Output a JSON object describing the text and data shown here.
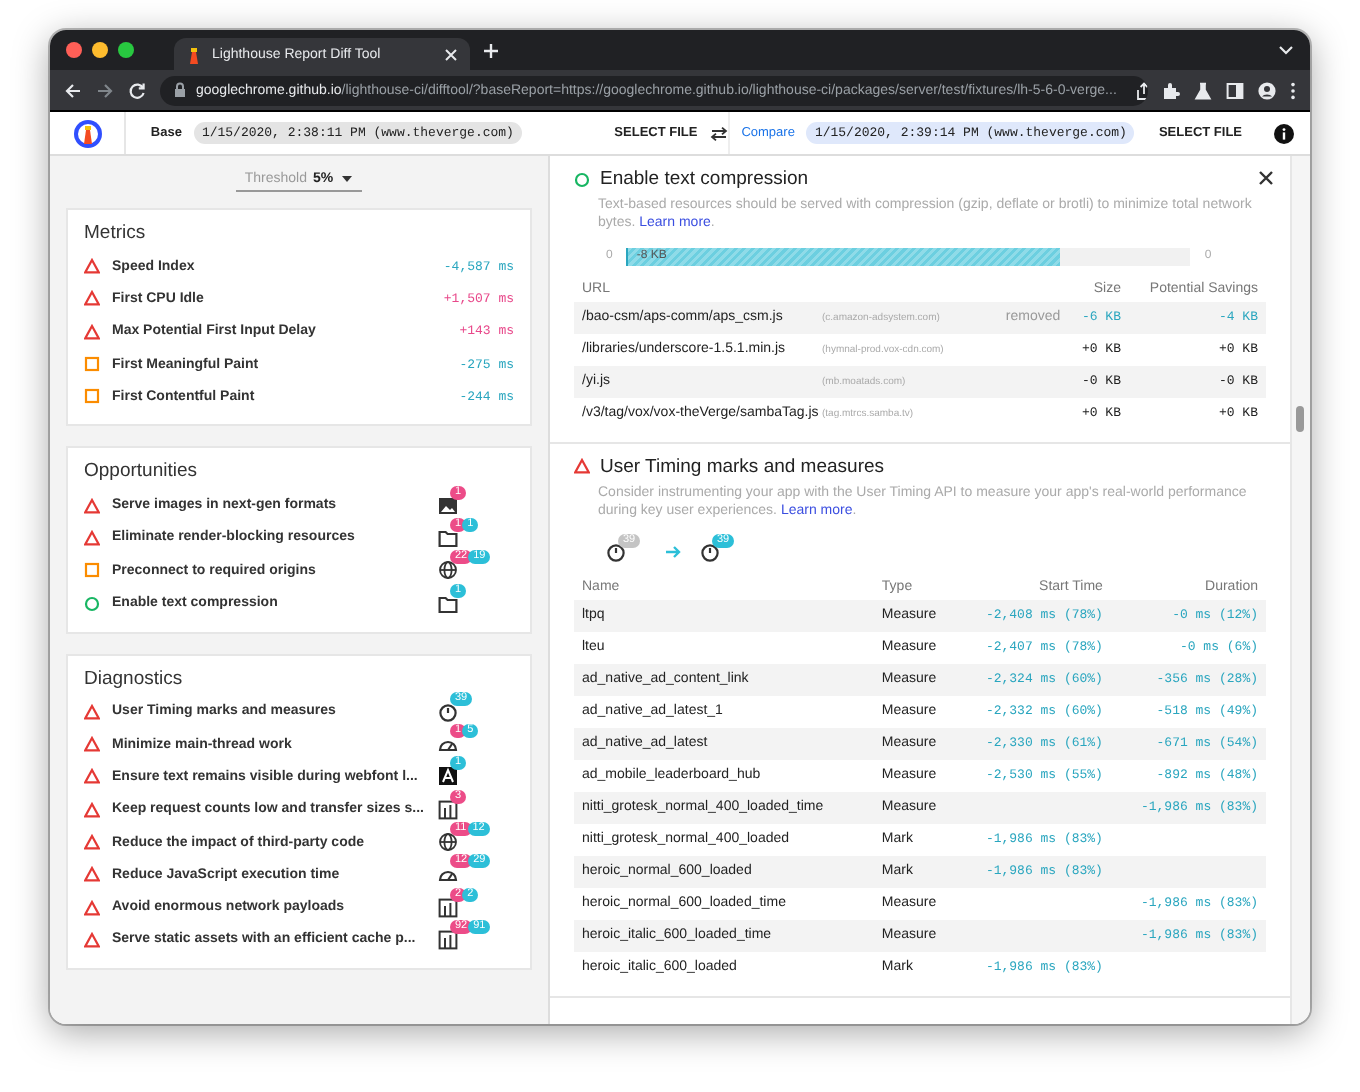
{
  "browser": {
    "tab_title": "Lighthouse Report Diff Tool",
    "url": "**googlechrome.github.io**/lighthouse-ci/difftool/?baseReport=https://googlechrome.github.io/lighthouse-ci/packages/server/test/fixtures/lh-5-6-0-verge..."
  },
  "header": {
    "base_label": "Base",
    "base_report": "1/15/2020, 2:38:11 PM (www.theverge.com)",
    "base_select": "SELECT FILE",
    "compare_label": "Compare",
    "compare_report": "1/15/2020, 2:39:14 PM (www.theverge.com)",
    "compare_select": "SELECT FILE"
  },
  "threshold": {
    "label": "Threshold",
    "value": "5%"
  },
  "sections": [
    {
      "title": "Metrics",
      "items": [
        {
          "label": "Speed Index",
          "kind": "fail",
          "delta": "-4,587 ms",
          "color": "#2aa6bf"
        },
        {
          "label": "First CPU Idle",
          "kind": "fail",
          "delta": "+1,507 ms",
          "color": "#e8488a"
        },
        {
          "label": "Max Potential First Input Delay",
          "kind": "fail",
          "delta": "+143 ms",
          "color": "#e8488a"
        },
        {
          "label": "First Meaningful Paint",
          "kind": "average",
          "delta": "-275 ms",
          "color": "#2aa6bf"
        },
        {
          "label": "First Contentful Paint",
          "kind": "average",
          "delta": "-244 ms",
          "color": "#2aa6bf"
        }
      ]
    },
    {
      "title": "Opportunities",
      "items": [
        {
          "label": "Serve images in next-gen formats",
          "kind": "fail",
          "badges": [
            {
              "text": "1",
              "color": "#ec4c88"
            }
          ]
        },
        {
          "label": "Eliminate render-blocking resources",
          "kind": "fail",
          "badges": [
            {
              "text": "1",
              "color": "#ec4c88"
            },
            {
              "text": "1",
              "color": "#2cbfd8"
            }
          ]
        },
        {
          "label": "Preconnect to required origins",
          "kind": "average",
          "badges": [
            {
              "text": "22",
              "color": "#ec4c88"
            },
            {
              "text": "19",
              "color": "#2cbfd8"
            }
          ]
        },
        {
          "label": "Enable text compression",
          "kind": "pass",
          "badges": [
            {
              "text": "1",
              "color": "#2cbfd8"
            }
          ]
        }
      ]
    },
    {
      "title": "Diagnostics",
      "items": [
        {
          "label": "User Timing marks and measures",
          "kind": "fail",
          "badges": [
            {
              "text": "39",
              "color": "#2cbfd8"
            }
          ]
        },
        {
          "label": "Minimize main-thread work",
          "kind": "fail",
          "badges": [
            {
              "text": "1",
              "color": "#ec4c88"
            },
            {
              "text": "5",
              "color": "#2cbfd8"
            }
          ]
        },
        {
          "label": "Ensure text remains visible during webfont l...",
          "kind": "fail",
          "badges": [
            {
              "text": "1",
              "color": "#2cbfd8"
            }
          ]
        },
        {
          "label": "Keep request counts low and transfer sizes s...",
          "kind": "fail",
          "badges": [
            {
              "text": "3",
              "color": "#ec4c88"
            }
          ]
        },
        {
          "label": "Reduce the impact of third-party code",
          "kind": "fail",
          "badges": [
            {
              "text": "11",
              "color": "#ec4c88"
            },
            {
              "text": "12",
              "color": "#2cbfd8"
            }
          ]
        },
        {
          "label": "Reduce JavaScript execution time",
          "kind": "fail",
          "badges": [
            {
              "text": "12",
              "color": "#ec4c88"
            },
            {
              "text": "29",
              "color": "#2cbfd8"
            }
          ]
        },
        {
          "label": "Avoid enormous network payloads",
          "kind": "fail",
          "badges": [
            {
              "text": "2",
              "color": "#ec4c88"
            },
            {
              "text": "2",
              "color": "#2cbfd8"
            }
          ]
        },
        {
          "label": "Serve static assets with an efficient cache p...",
          "kind": "fail",
          "badges": [
            {
              "text": "92",
              "color": "#ec4c88"
            },
            {
              "text": "91",
              "color": "#2cbfd8"
            }
          ]
        }
      ]
    }
  ],
  "details": [
    {
      "kind": "resources",
      "heading": {
        "kind": "pass",
        "title": "Enable text compression"
      },
      "description": "Text-based resources should be served with compression (gzip, deflate or brotli) to minimize total network bytes.",
      "link": "Learn more",
      "end": ".",
      "bar": {
        "min": "0",
        "max": "0",
        "value": "-8 KB",
        "level": 0.77
      },
      "columns": [
        "URL",
        "Size",
        "Potential Savings"
      ],
      "rows": [
        {
          "url": "/bao-csm/aps-comm/aps_csm.js",
          "host": "(c.amazon-adsystem.com)",
          "note": "removed",
          "size": "-6 KB",
          "savings": "-4 KB",
          "changed": true
        },
        {
          "url": "/libraries/underscore-1.5.1.min.js",
          "host": "(hymnal-prod.vox-cdn.com)",
          "size": "+0 KB",
          "savings": "+0 KB",
          "changed": false
        },
        {
          "url": "/yi.js",
          "host": "(mb.moatads.com)",
          "size": "-0 KB",
          "savings": "-0 KB",
          "changed": false
        },
        {
          "url": "/v3/tag/vox/vox-theVerge/sambaTag.js",
          "host": "(tag.mtrcs.samba.tv)",
          "size": "+0 KB",
          "savings": "+0 KB",
          "changed": false
        }
      ]
    },
    {
      "kind": "timings",
      "heading": {
        "kind": "fail",
        "title": "User Timing marks and measures"
      },
      "description": "Consider instrumenting your app with the User Timing API to measure your app's real-world performance during key user experiences.",
      "link": "Learn more",
      "end": ".",
      "before": {
        "text": "39",
        "color": "#c4c4c4"
      },
      "after": {
        "text": "39",
        "color": "#2cbfd8"
      },
      "columns": [
        "Name",
        "Type",
        "Start Time",
        "Duration"
      ],
      "rows": [
        {
          "name": "ltpq",
          "type": "Measure",
          "start": "-2,408 ms (78%)",
          "duration": "-0 ms (12%)"
        },
        {
          "name": "lteu",
          "type": "Measure",
          "start": "-2,407 ms (78%)",
          "duration": "-0 ms (6%)"
        },
        {
          "name": "ad_native_ad_content_link",
          "type": "Measure",
          "start": "-2,324 ms (60%)",
          "duration": "-356 ms (28%)"
        },
        {
          "name": "ad_native_ad_latest_1",
          "type": "Measure",
          "start": "-2,332 ms (60%)",
          "duration": "-518 ms (49%)"
        },
        {
          "name": "ad_native_ad_latest",
          "type": "Measure",
          "start": "-2,330 ms (61%)",
          "duration": "-671 ms (54%)"
        },
        {
          "name": "ad_mobile_leaderboard_hub",
          "type": "Measure",
          "start": "-2,530 ms (55%)",
          "duration": "-892 ms (48%)"
        },
        {
          "name": "nitti_grotesk_normal_400_loaded_time",
          "type": "Measure",
          "duration": "-1,986 ms (83%)"
        },
        {
          "name": "nitti_grotesk_normal_400_loaded",
          "type": "Mark",
          "start": "-1,986 ms (83%)"
        },
        {
          "name": "heroic_normal_600_loaded",
          "type": "Mark",
          "start": "-1,986 ms (83%)"
        },
        {
          "name": "heroic_normal_600_loaded_time",
          "type": "Measure",
          "duration": "-1,986 ms (83%)"
        },
        {
          "name": "heroic_italic_600_loaded_time",
          "type": "Measure",
          "duration": "-1,986 ms (83%)"
        },
        {
          "name": "heroic_italic_600_loaded",
          "type": "Mark",
          "start": "-1,986 ms (83%)"
        }
      ]
    }
  ]
}
